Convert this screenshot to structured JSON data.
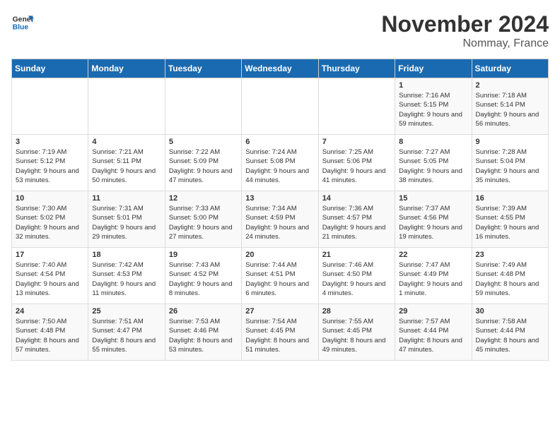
{
  "logo": {
    "line1": "General",
    "line2": "Blue"
  },
  "title": "November 2024",
  "location": "Nommay, France",
  "days_of_week": [
    "Sunday",
    "Monday",
    "Tuesday",
    "Wednesday",
    "Thursday",
    "Friday",
    "Saturday"
  ],
  "weeks": [
    [
      {
        "day": "",
        "info": ""
      },
      {
        "day": "",
        "info": ""
      },
      {
        "day": "",
        "info": ""
      },
      {
        "day": "",
        "info": ""
      },
      {
        "day": "",
        "info": ""
      },
      {
        "day": "1",
        "info": "Sunrise: 7:16 AM\nSunset: 5:15 PM\nDaylight: 9 hours and 59 minutes."
      },
      {
        "day": "2",
        "info": "Sunrise: 7:18 AM\nSunset: 5:14 PM\nDaylight: 9 hours and 56 minutes."
      }
    ],
    [
      {
        "day": "3",
        "info": "Sunrise: 7:19 AM\nSunset: 5:12 PM\nDaylight: 9 hours and 53 minutes."
      },
      {
        "day": "4",
        "info": "Sunrise: 7:21 AM\nSunset: 5:11 PM\nDaylight: 9 hours and 50 minutes."
      },
      {
        "day": "5",
        "info": "Sunrise: 7:22 AM\nSunset: 5:09 PM\nDaylight: 9 hours and 47 minutes."
      },
      {
        "day": "6",
        "info": "Sunrise: 7:24 AM\nSunset: 5:08 PM\nDaylight: 9 hours and 44 minutes."
      },
      {
        "day": "7",
        "info": "Sunrise: 7:25 AM\nSunset: 5:06 PM\nDaylight: 9 hours and 41 minutes."
      },
      {
        "day": "8",
        "info": "Sunrise: 7:27 AM\nSunset: 5:05 PM\nDaylight: 9 hours and 38 minutes."
      },
      {
        "day": "9",
        "info": "Sunrise: 7:28 AM\nSunset: 5:04 PM\nDaylight: 9 hours and 35 minutes."
      }
    ],
    [
      {
        "day": "10",
        "info": "Sunrise: 7:30 AM\nSunset: 5:02 PM\nDaylight: 9 hours and 32 minutes."
      },
      {
        "day": "11",
        "info": "Sunrise: 7:31 AM\nSunset: 5:01 PM\nDaylight: 9 hours and 29 minutes."
      },
      {
        "day": "12",
        "info": "Sunrise: 7:33 AM\nSunset: 5:00 PM\nDaylight: 9 hours and 27 minutes."
      },
      {
        "day": "13",
        "info": "Sunrise: 7:34 AM\nSunset: 4:59 PM\nDaylight: 9 hours and 24 minutes."
      },
      {
        "day": "14",
        "info": "Sunrise: 7:36 AM\nSunset: 4:57 PM\nDaylight: 9 hours and 21 minutes."
      },
      {
        "day": "15",
        "info": "Sunrise: 7:37 AM\nSunset: 4:56 PM\nDaylight: 9 hours and 19 minutes."
      },
      {
        "day": "16",
        "info": "Sunrise: 7:39 AM\nSunset: 4:55 PM\nDaylight: 9 hours and 16 minutes."
      }
    ],
    [
      {
        "day": "17",
        "info": "Sunrise: 7:40 AM\nSunset: 4:54 PM\nDaylight: 9 hours and 13 minutes."
      },
      {
        "day": "18",
        "info": "Sunrise: 7:42 AM\nSunset: 4:53 PM\nDaylight: 9 hours and 11 minutes."
      },
      {
        "day": "19",
        "info": "Sunrise: 7:43 AM\nSunset: 4:52 PM\nDaylight: 9 hours and 8 minutes."
      },
      {
        "day": "20",
        "info": "Sunrise: 7:44 AM\nSunset: 4:51 PM\nDaylight: 9 hours and 6 minutes."
      },
      {
        "day": "21",
        "info": "Sunrise: 7:46 AM\nSunset: 4:50 PM\nDaylight: 9 hours and 4 minutes."
      },
      {
        "day": "22",
        "info": "Sunrise: 7:47 AM\nSunset: 4:49 PM\nDaylight: 9 hours and 1 minute."
      },
      {
        "day": "23",
        "info": "Sunrise: 7:49 AM\nSunset: 4:48 PM\nDaylight: 8 hours and 59 minutes."
      }
    ],
    [
      {
        "day": "24",
        "info": "Sunrise: 7:50 AM\nSunset: 4:48 PM\nDaylight: 8 hours and 57 minutes."
      },
      {
        "day": "25",
        "info": "Sunrise: 7:51 AM\nSunset: 4:47 PM\nDaylight: 8 hours and 55 minutes."
      },
      {
        "day": "26",
        "info": "Sunrise: 7:53 AM\nSunset: 4:46 PM\nDaylight: 8 hours and 53 minutes."
      },
      {
        "day": "27",
        "info": "Sunrise: 7:54 AM\nSunset: 4:45 PM\nDaylight: 8 hours and 51 minutes."
      },
      {
        "day": "28",
        "info": "Sunrise: 7:55 AM\nSunset: 4:45 PM\nDaylight: 8 hours and 49 minutes."
      },
      {
        "day": "29",
        "info": "Sunrise: 7:57 AM\nSunset: 4:44 PM\nDaylight: 8 hours and 47 minutes."
      },
      {
        "day": "30",
        "info": "Sunrise: 7:58 AM\nSunset: 4:44 PM\nDaylight: 8 hours and 45 minutes."
      }
    ]
  ]
}
